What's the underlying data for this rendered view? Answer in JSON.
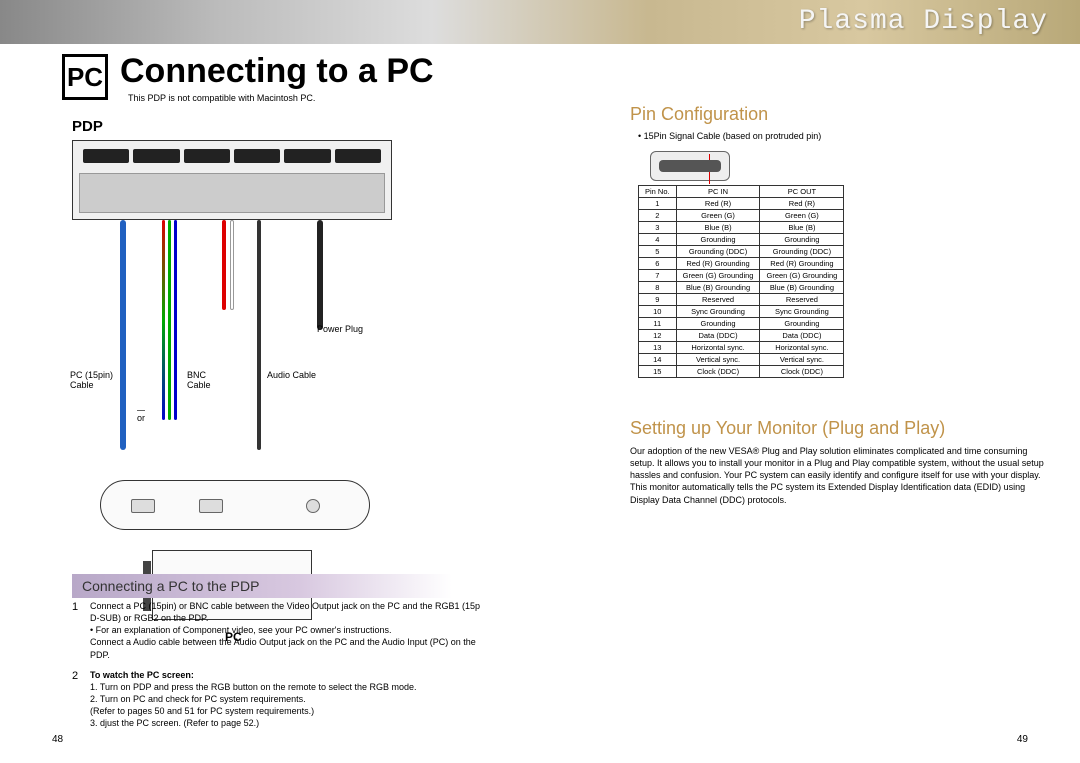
{
  "header": {
    "plasma": "Plasma Display",
    "pc_badge": "PC",
    "title": "Connecting to a PC",
    "note": "This PDP is not compatible with Macintosh PC."
  },
  "diagram": {
    "pdp_label": "PDP",
    "pc15_label_1": "PC (15pin)",
    "pc15_label_2": "Cable",
    "bnc_label_1": "BNC",
    "bnc_label_2": "Cable",
    "audio_label": "Audio Cable",
    "power_label": "Power Plug",
    "or_label": "or",
    "pc_label": "PC"
  },
  "left_section": {
    "title": "Connecting a PC to the PDP",
    "step1_num": "1",
    "step1_body": "Connect a PC (15pin) or BNC cable between the Video Output jack on the PC and the RGB1 (15p D-SUB) or RGB2 on the PDP.\n•  For an explanation of Component video, see your PC owner's instructions.\nConnect a Audio cable between the Audio Output jack on the PC and the Audio Input (PC) on the PDP.",
    "step2_num": "2",
    "step2_bold": "To watch the PC screen:",
    "step2_body": "1. Turn on PDP and press the RGB button on the remote to select the RGB mode.\n2. Turn on PC and check for PC system requirements.\n    (Refer to pages 50 and 51 for PC system requirements.)\n3. djust the PC screen. (Refer to page 52.)"
  },
  "pin_section": {
    "title": "Pin Configuration",
    "note": "• 15Pin Signal Cable (based on protruded pin)",
    "headers": [
      "Pin No.",
      "PC IN",
      "PC OUT"
    ],
    "rows": [
      [
        "1",
        "Red (R)",
        "Red (R)"
      ],
      [
        "2",
        "Green (G)",
        "Green (G)"
      ],
      [
        "3",
        "Blue (B)",
        "Blue (B)"
      ],
      [
        "4",
        "Grounding",
        "Grounding"
      ],
      [
        "5",
        "Grounding (DDC)",
        "Grounding (DDC)"
      ],
      [
        "6",
        "Red (R) Grounding",
        "Red (R) Grounding"
      ],
      [
        "7",
        "Green (G) Grounding",
        "Green (G) Grounding"
      ],
      [
        "8",
        "Blue (B) Grounding",
        "Blue (B) Grounding"
      ],
      [
        "9",
        "Reserved",
        "Reserved"
      ],
      [
        "10",
        "Sync Grounding",
        "Sync Grounding"
      ],
      [
        "11",
        "Grounding",
        "Grounding"
      ],
      [
        "12",
        "Data (DDC)",
        "Data (DDC)"
      ],
      [
        "13",
        "Horizontal sync.",
        "Horizontal sync."
      ],
      [
        "14",
        "Vertical sync.",
        "Vertical sync."
      ],
      [
        "15",
        "Clock (DDC)",
        "Clock (DDC)"
      ]
    ]
  },
  "setup_section": {
    "title": "Setting up Your Monitor (Plug and Play)",
    "text": "Our adoption of the new VESA® Plug and Play solution eliminates complicated and time consuming setup. It allows you to install your monitor in a Plug and Play compatible system, without the usual setup hassles and confusion. Your PC system can easily identify and configure itself for use with your display. This monitor automatically tells the PC system its Extended Display Identification data (EDID) using Display Data Channel (DDC) protocols."
  },
  "pages": {
    "left": "48",
    "right": "49"
  }
}
